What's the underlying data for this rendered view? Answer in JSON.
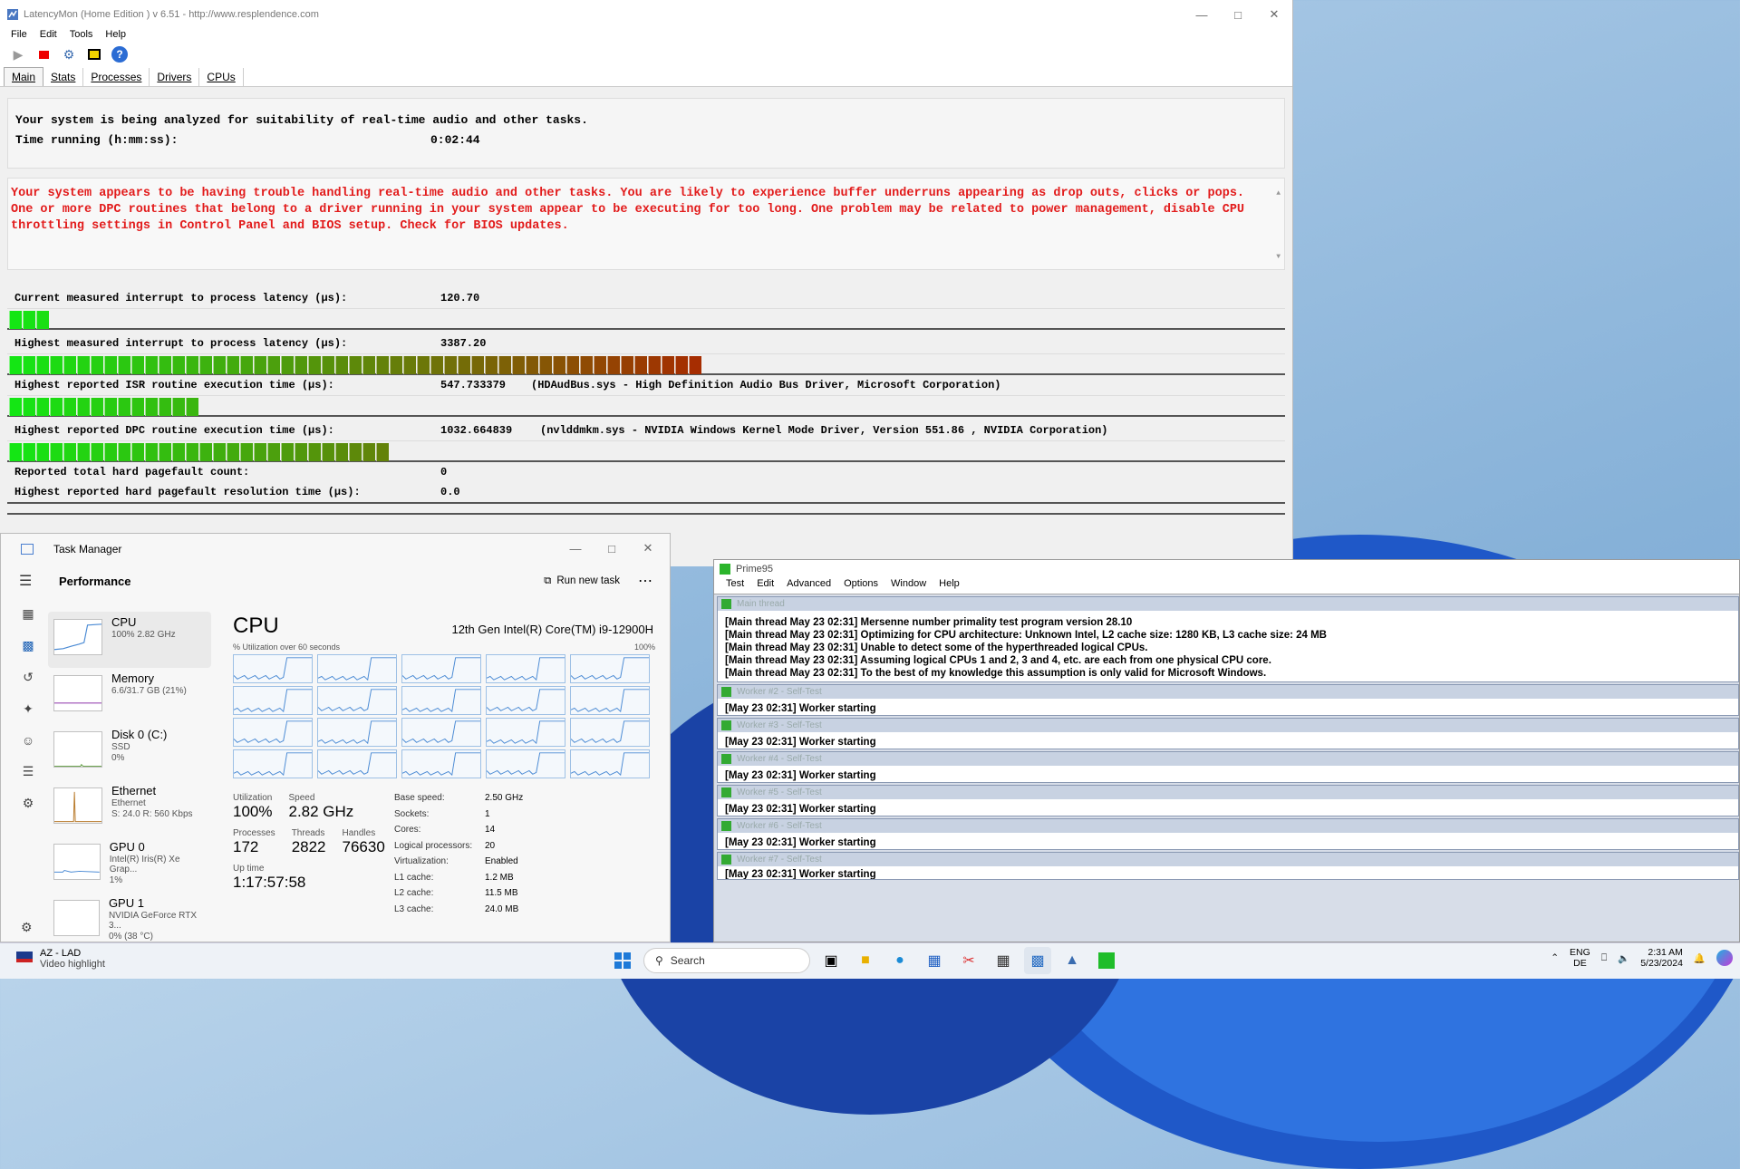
{
  "latencymon": {
    "title": "LatencyMon  (Home Edition )  v 6.51 - http://www.resplendence.com",
    "menu": [
      "File",
      "Edit",
      "Tools",
      "Help"
    ],
    "tabs": [
      "Main",
      "Stats",
      "Processes",
      "Drivers",
      "CPUs"
    ],
    "status_line": "Your system is being analyzed for suitability of real-time audio and other tasks.",
    "time_label": "Time running (h:mm:ss):",
    "time_value": "0:02:44",
    "warning": "Your system appears to be having trouble handling real-time audio and other tasks. You are likely to experience buffer underruns appearing as drop outs, clicks or pops. One or more DPC routines that belong to a driver running in your system appear to be executing for too long. One problem may be related to power management, disable CPU throttling settings in Control Panel and BIOS setup. Check for BIOS updates.",
    "metrics": [
      {
        "label": "Current measured interrupt to process latency (µs):",
        "value": "120.70",
        "extra": "",
        "bar_fraction": 0.036
      },
      {
        "label": "Highest measured interrupt to process latency (µs):",
        "value": "3387.20",
        "extra": "",
        "bar_fraction": 0.55
      },
      {
        "label": "Highest reported ISR routine execution time (µs):",
        "value": "547.733379",
        "extra": "(HDAudBus.sys - High Definition Audio Bus Driver, Microsoft Corporation)",
        "bar_fraction": 0.15
      },
      {
        "label": "Highest reported DPC routine execution time (µs):",
        "value": "1032.664839",
        "extra": "(nvlddmkm.sys - NVIDIA Windows Kernel Mode Driver, Version 551.86 , NVIDIA Corporation)",
        "bar_fraction": 0.3
      },
      {
        "label": "Reported total hard pagefault count:",
        "value": "0",
        "extra": ""
      },
      {
        "label": "Highest reported hard pagefault resolution time (µs):",
        "value": "0.0",
        "extra": ""
      }
    ]
  },
  "taskmanager": {
    "title": "Task Manager",
    "section": "Performance",
    "run_new_task": "Run new task",
    "items": [
      {
        "name": "CPU",
        "detail": "100%  2.82 GHz",
        "detail2": ""
      },
      {
        "name": "Memory",
        "detail": "6.6/31.7 GB (21%)",
        "detail2": ""
      },
      {
        "name": "Disk 0 (C:)",
        "detail": "SSD",
        "detail2": "0%"
      },
      {
        "name": "Ethernet",
        "detail": "Ethernet",
        "detail2": "S: 24.0  R: 560 Kbps"
      },
      {
        "name": "GPU 0",
        "detail": "Intel(R) Iris(R) Xe Grap...",
        "detail2": "1%"
      },
      {
        "name": "GPU 1",
        "detail": "NVIDIA GeForce RTX 3...",
        "detail2": "0%  (38 °C)"
      }
    ],
    "main_title": "CPU",
    "processor": "12th Gen Intel(R) Core(TM) i9-12900H",
    "util_label": "% Utilization over 60 seconds",
    "util_max": "100%",
    "stats": {
      "utilization_label": "Utilization",
      "utilization": "100%",
      "speed_label": "Speed",
      "speed": "2.82 GHz",
      "processes_label": "Processes",
      "processes": "172",
      "threads_label": "Threads",
      "threads": "2822",
      "handles_label": "Handles",
      "handles": "76630",
      "uptime_label": "Up time",
      "uptime": "1:17:57:58"
    },
    "specs": [
      {
        "k": "Base speed:",
        "v": "2.50 GHz"
      },
      {
        "k": "Sockets:",
        "v": "1"
      },
      {
        "k": "Cores:",
        "v": "14"
      },
      {
        "k": "Logical processors:",
        "v": "20"
      },
      {
        "k": "Virtualization:",
        "v": "Enabled"
      },
      {
        "k": "L1 cache:",
        "v": "1.2 MB"
      },
      {
        "k": "L2 cache:",
        "v": "11.5 MB"
      },
      {
        "k": "L3 cache:",
        "v": "24.0 MB"
      }
    ]
  },
  "prime95": {
    "title": "Prime95",
    "menu": [
      "Test",
      "Edit",
      "Advanced",
      "Options",
      "Window",
      "Help"
    ],
    "main_thread_title": "Main thread",
    "main_lines": [
      "[Main thread May 23 02:31] Mersenne number primality test program version 28.10",
      "[Main thread May 23 02:31] Optimizing for CPU architecture: Unknown Intel, L2 cache size: 1280 KB, L3 cache size: 24 MB",
      "[Main thread May 23 02:31] Unable to detect some of the hyperthreaded logical CPUs.",
      "[Main thread May 23 02:31] Assuming logical CPUs 1 and 2, 3 and 4, etc. are each from one physical CPU core.",
      "[Main thread May 23 02:31] To the best of my knowledge this assumption is only valid for Microsoft Windows."
    ],
    "workers": [
      {
        "title": "Worker #2 - Self-Test",
        "line": "[May 23 02:31] Worker starting"
      },
      {
        "title": "Worker #3 - Self-Test",
        "line": "[May 23 02:31] Worker starting"
      },
      {
        "title": "Worker #4 - Self-Test",
        "line": "[May 23 02:31] Worker starting"
      },
      {
        "title": "Worker #5 - Self-Test",
        "line": "[May 23 02:31] Worker starting"
      },
      {
        "title": "Worker #6 - Self-Test",
        "line": "[May 23 02:31] Worker starting"
      },
      {
        "title": "Worker #7 - Self-Test",
        "line": "[May 23 02:31] Worker starting"
      }
    ]
  },
  "taskbar": {
    "weather_title": "AZ - LAD",
    "weather_sub": "Video highlight",
    "search_placeholder": "Search",
    "lang": "ENG",
    "lang2": "DE",
    "time": "2:31 AM",
    "date": "5/23/2024"
  }
}
